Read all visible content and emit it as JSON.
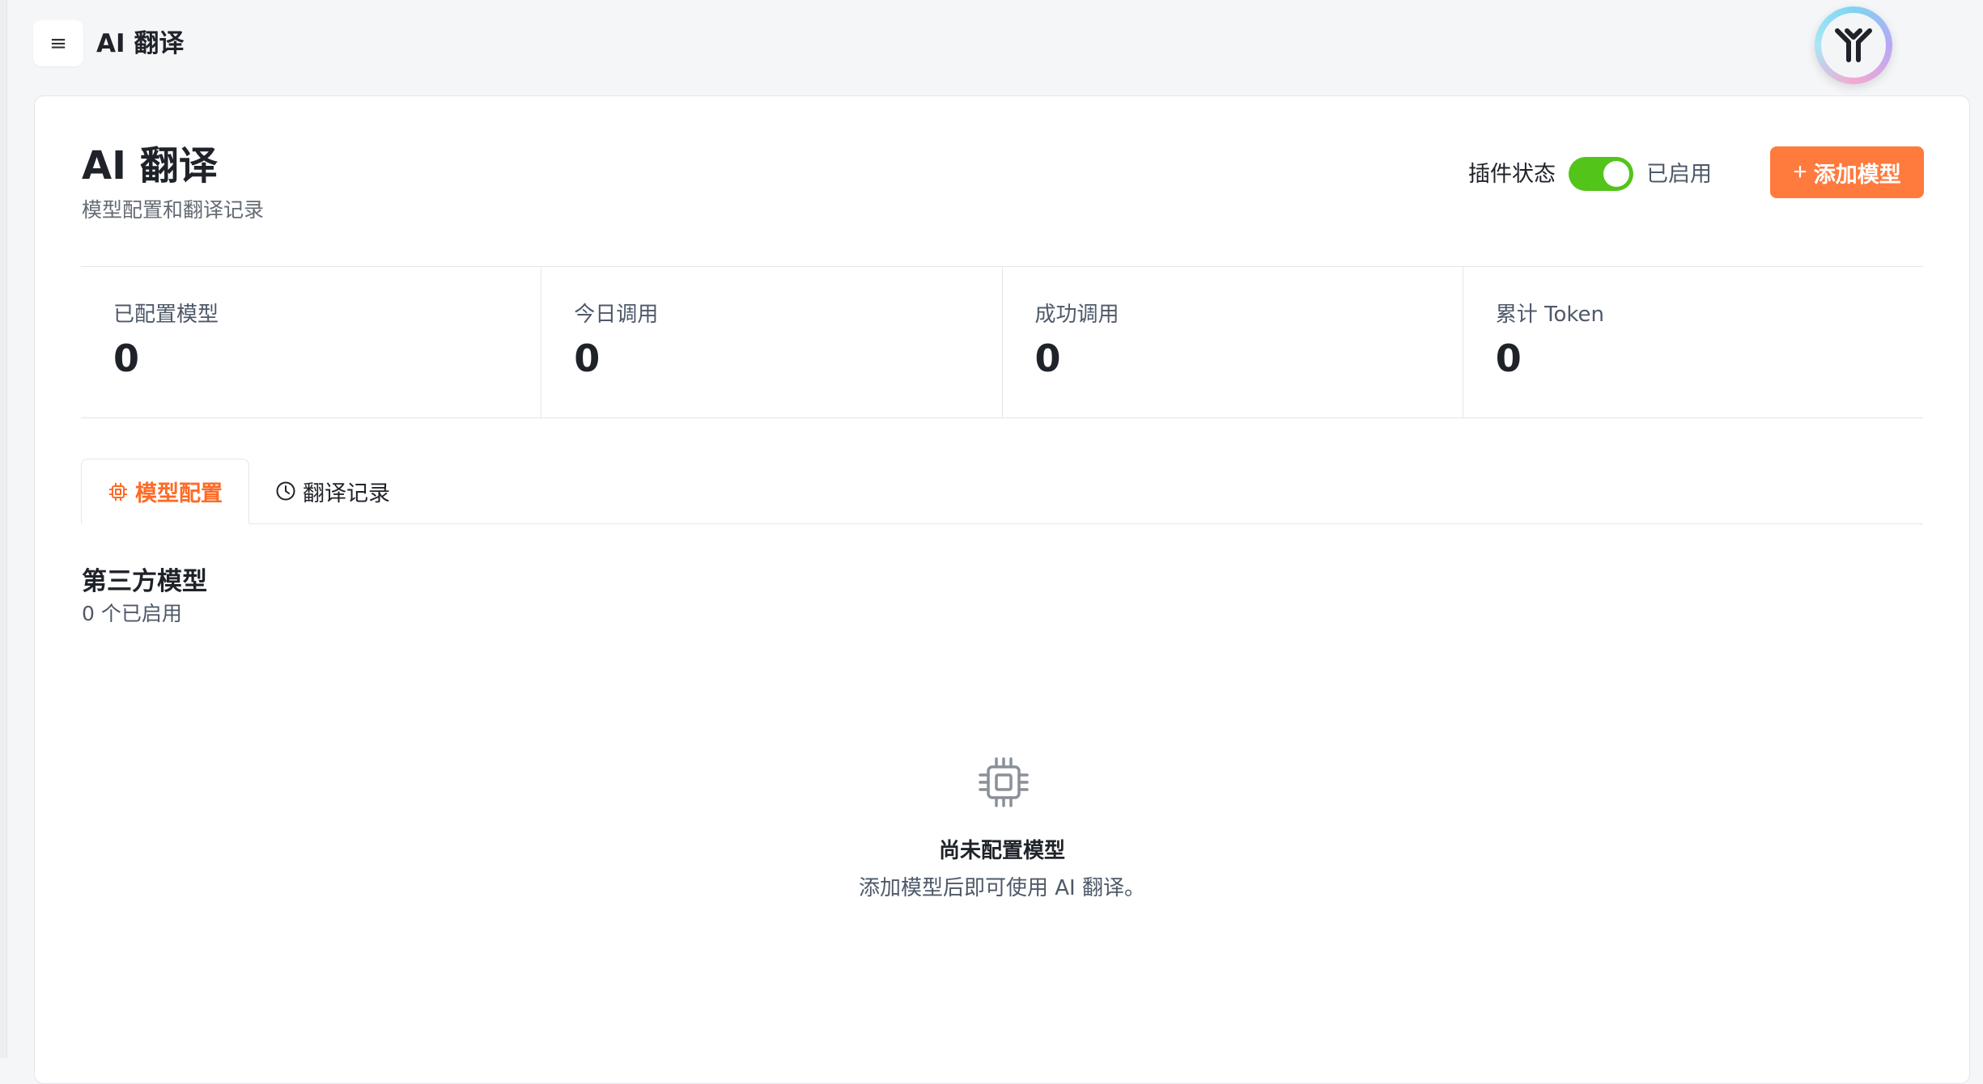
{
  "header": {
    "menu_icon": "hamburger-icon",
    "title": "AI 翻译",
    "avatar_icon": "brand-logo"
  },
  "page": {
    "title": "AI 翻译",
    "subtitle": "模型配置和翻译记录",
    "plugin_status_label": "插件状态",
    "plugin_status_value": "已启用",
    "plugin_enabled": true,
    "add_model_label": "添加模型",
    "accent_color": "#ff7a3d",
    "toggle_color": "#52c41a"
  },
  "stats": [
    {
      "label": "已配置模型",
      "value": "0"
    },
    {
      "label": "今日调用",
      "value": "0"
    },
    {
      "label": "成功调用",
      "value": "0"
    },
    {
      "label": "累计 Token",
      "value": "0"
    }
  ],
  "tabs": [
    {
      "label": "模型配置",
      "icon": "chip-icon",
      "active": true
    },
    {
      "label": "翻译记录",
      "icon": "clock-icon",
      "active": false
    }
  ],
  "section": {
    "title": "第三方模型",
    "subtitle": "0 个已启用"
  },
  "empty_state": {
    "icon": "chip-icon",
    "title": "尚未配置模型",
    "description": "添加模型后即可使用 AI 翻译。"
  }
}
